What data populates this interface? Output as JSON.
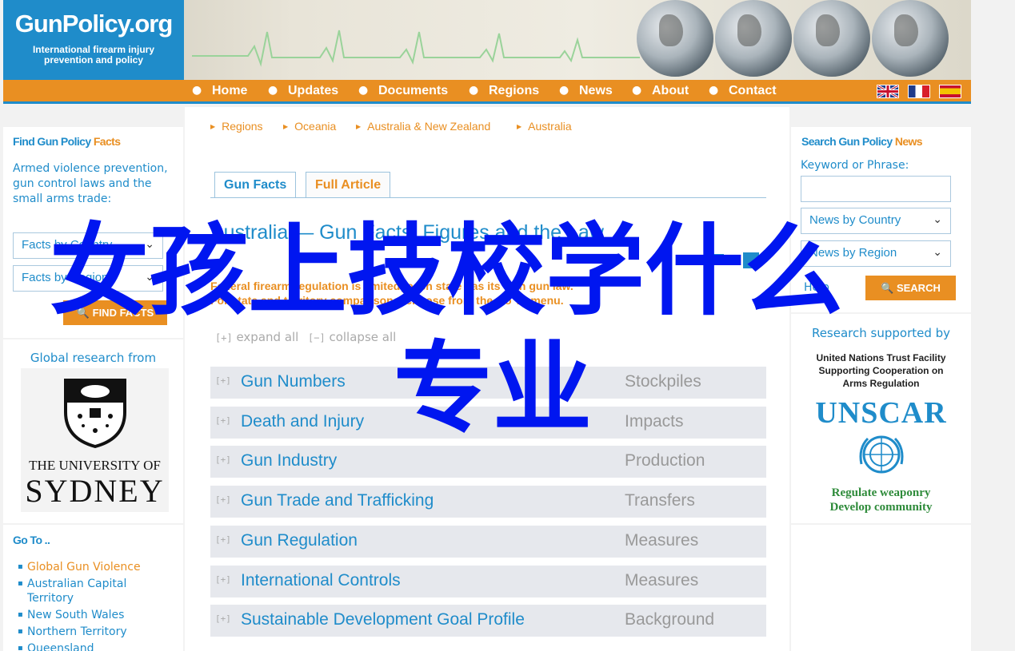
{
  "logo": {
    "name": "GunPolicy.org",
    "tagline_1": "International firearm injury",
    "tagline_2": "prevention and policy"
  },
  "nav": {
    "items": [
      "Home",
      "Updates",
      "Documents",
      "Regions",
      "News",
      "About",
      "Contact"
    ]
  },
  "left": {
    "find_title_a": "Find Gun Policy",
    "find_title_b": "Facts",
    "find_desc": "Armed violence prevention, gun control laws and the small arms trade:",
    "select_country": "Facts by Country",
    "select_region": "Facts by Region",
    "find_button": "FIND FACTS",
    "global_research": "Global research from",
    "univ_line1": "THE UNIVERSITY OF",
    "univ_line2": "SYDNEY",
    "goto_title": "Go To ..",
    "goto_items": [
      "Global Gun Violence",
      "Australian Capital Territory",
      "New South Wales",
      "Northern Territory",
      "Queensland"
    ]
  },
  "breadcrumb": [
    "Regions",
    "Oceania",
    "Australia & New Zealand",
    "Australia"
  ],
  "tabs": {
    "gun_facts": "Gun Facts",
    "full_article": "Full Article"
  },
  "article": {
    "title": "Australia — Gun Facts, Figures and the Law",
    "note_1": "Federal firearm regulation is limited; each state has its own gun law.",
    "note_2": "For state and territory comparisons, choose from the Go To menu.",
    "expand_all": "expand all",
    "collapse_all": "collapse all",
    "expand_symbol": "[+]",
    "collapse_symbol": "[−]"
  },
  "sections": [
    {
      "label": "Gun Numbers",
      "category": "Stockpiles"
    },
    {
      "label": "Death and Injury",
      "category": "Impacts"
    },
    {
      "label": "Gun Industry",
      "category": "Production"
    },
    {
      "label": "Gun Trade and Trafficking",
      "category": "Transfers"
    },
    {
      "label": "Gun Regulation",
      "category": "Measures"
    },
    {
      "label": "International Controls",
      "category": "Measures"
    },
    {
      "label": "Sustainable Development Goal Profile",
      "category": "Background"
    }
  ],
  "right": {
    "search_title_a": "Search Gun Policy",
    "search_title_b": "News",
    "keyword_label": "Keyword or Phrase:",
    "keyword_value": "",
    "select_country": "News by Country",
    "select_region": "News by Region",
    "help": "Help",
    "search_button": "SEARCH",
    "research_supported": "Research supported by",
    "un_line1": "United Nations Trust Facility",
    "un_line2": "Supporting Cooperation on",
    "un_line3": "Arms Regulation",
    "unscar": "UNSCAR",
    "motto_1": "Regulate weaponry",
    "motto_2": "Develop community"
  },
  "overlay": {
    "line1": "女孩上技校学什么",
    "line2": "专业"
  },
  "colors": {
    "brand_blue": "#1f8cca",
    "brand_orange": "#e98f22",
    "overlay_blue": "#0016f0",
    "unscar_green": "#2e8b3a"
  }
}
